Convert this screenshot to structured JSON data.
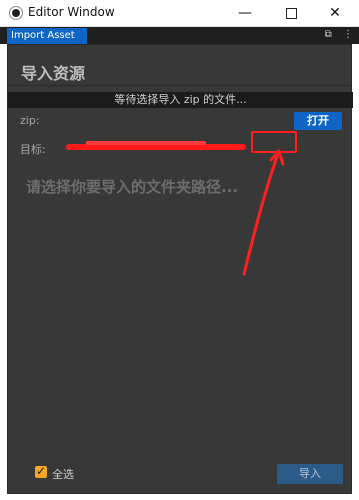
{
  "window": {
    "title": "Editor Window",
    "controls": {
      "minimize": "—",
      "maximize": "",
      "close": "✕"
    }
  },
  "tabs": [
    {
      "label": "Import Asset"
    }
  ],
  "tab_icons": {
    "restore": "⧉",
    "menu": "⋮"
  },
  "panel": {
    "heading": "导入资源",
    "status": "等待选择导入 zip 的文件...",
    "zip_label": "zip:",
    "open_button": "打开",
    "target_label": "目标:",
    "drop_hint": "请选择你要导入的文件夹路径...",
    "select_all_label": "全选",
    "select_all_checked": true,
    "import_button": "导入"
  },
  "colors": {
    "accent": "#0f65c6",
    "panel_bg": "#383838",
    "annotation_red": "#ff1f1f",
    "checkbox": "#f5a623"
  }
}
